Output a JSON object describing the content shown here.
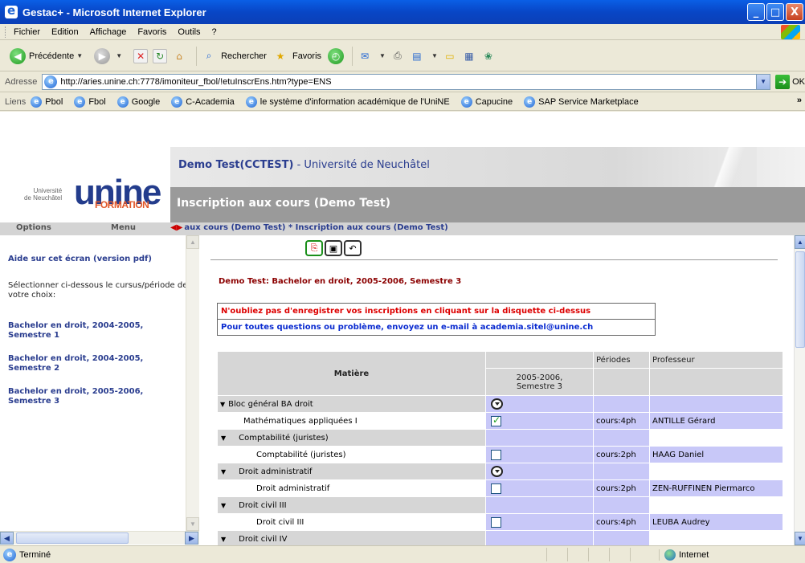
{
  "window": {
    "title": "Gestac+ - Microsoft Internet Explorer",
    "buttons": [
      "_",
      "□",
      "X"
    ]
  },
  "menu": [
    "Fichier",
    "Edition",
    "Affichage",
    "Favoris",
    "Outils",
    "?"
  ],
  "toolbar": {
    "back_label": "Précédente",
    "search_label": "Rechercher",
    "favorites_label": "Favoris"
  },
  "address": {
    "label": "Adresse",
    "url": "http://aries.unine.ch:7778/imoniteur_fbol/!etuInscrEns.htm?type=ENS",
    "go_label": "OK"
  },
  "links": {
    "label": "Liens",
    "items": [
      "Pbol",
      "Fbol",
      "Google",
      "C-Academia",
      "le système d'information académique de l'UniNE",
      "Capucine",
      "SAP Service Marketplace"
    ],
    "more": "»"
  },
  "logo": {
    "small_line1": "Université",
    "small_line2": "de Neuchâtel",
    "big": "unine",
    "formation": "FORMATION"
  },
  "header": {
    "user_bold": "Demo Test(CCTEST)",
    "user_rest": " - Université de Neuchâtel",
    "page_title": "Inscription aux cours (Demo Test)"
  },
  "navstrip": {
    "options": "Options",
    "menu": "Menu",
    "breadcrumb": "aux cours (Demo Test) * Inscription aux cours (Demo Test)"
  },
  "sidebar": {
    "help": "Aide sur cet écran (version pdf)",
    "instructions": "Sélectionner ci-dessous le cursus/période de votre choix:",
    "items": [
      "Bachelor en droit, 2004-2005, Semestre 1",
      "Bachelor en droit, 2004-2005, Semestre 2",
      "Bachelor en droit, 2005-2006, Semestre 3"
    ]
  },
  "main": {
    "subtitle": "Demo Test: Bachelor en droit, 2005-2006, Semestre 3",
    "notice_save": "N'oubliez pas d'enregistrer vos inscriptions en cliquant sur la disquette ci-dessus",
    "notice_contact": "Pour toutes questions ou problème, envoyez un e-mail à academia.sitel@unine.ch",
    "table": {
      "headers": {
        "matiere": "Matière",
        "periodes": "Périodes",
        "professeur": "Professeur",
        "period_col_line1": "2005-2006,",
        "period_col_line2": "Semestre 3"
      },
      "rows": [
        {
          "kind": "bloc",
          "name": "Bloc général BA droit",
          "control": "dropdown",
          "periodes": "",
          "prof": ""
        },
        {
          "kind": "course",
          "name": "Mathématiques appliquées I",
          "control": "checked",
          "periodes": "cours:4ph",
          "prof": "ANTILLE Gérard"
        },
        {
          "kind": "group",
          "name": "Comptabilité (juristes)",
          "control": "none",
          "periodes": "",
          "prof": ""
        },
        {
          "kind": "course2",
          "name": "Comptabilité (juristes)",
          "control": "unchecked",
          "periodes": "cours:2ph",
          "prof": "HAAG Daniel"
        },
        {
          "kind": "group",
          "name": "Droit administratif",
          "control": "dropdown",
          "periodes": "",
          "prof": ""
        },
        {
          "kind": "course2",
          "name": "Droit administratif",
          "control": "unchecked",
          "periodes": "cours:2ph",
          "prof": "ZEN-RUFFINEN Piermarco"
        },
        {
          "kind": "group",
          "name": "Droit civil III",
          "control": "none",
          "periodes": "",
          "prof": ""
        },
        {
          "kind": "course2",
          "name": "Droit civil III",
          "control": "unchecked",
          "periodes": "cours:4ph",
          "prof": "LEUBA Audrey"
        },
        {
          "kind": "group",
          "name": "Droit civil IV",
          "control": "none",
          "periodes": "",
          "prof": ""
        }
      ]
    }
  },
  "status": {
    "text": "Terminé",
    "zone": "Internet"
  }
}
